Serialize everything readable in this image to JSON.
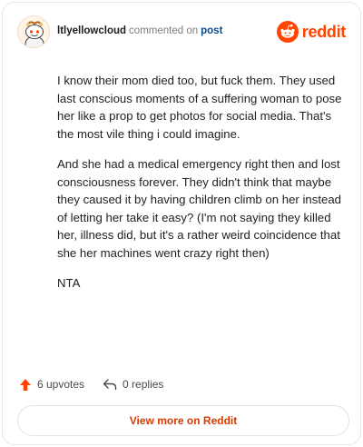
{
  "header": {
    "username": "ltlyellowcloud",
    "action_text": "commented on",
    "post_link": "post",
    "brand_name": "reddit"
  },
  "comment": {
    "paragraphs": [
      "I know their mom died too, but fuck them. They used last conscious moments of a suffering woman to pose her like a prop to get photos for social media. That's the most vile thing i could imagine.",
      "And she had a medical emergency right then and lost consciousness forever. They didn't think that maybe they caused it by having children climb on her instead of letting her take it easy? (I'm not saying they killed her, illness did, but it's a rather weird coincidence that she her machines went crazy right then)",
      "NTA"
    ]
  },
  "stats": {
    "upvotes_label": "6 upvotes",
    "replies_label": "0 replies"
  },
  "view_more_label": "View more on Reddit",
  "colors": {
    "brand": "#ff4500",
    "link": "#0a4a8f",
    "upvote": "#ff4500",
    "cta": "#d93a00"
  },
  "icons": {
    "avatar": "snoo-avatar",
    "brand": "reddit-logo-icon",
    "upvote": "upvote-arrow-icon",
    "reply": "reply-arrow-icon"
  }
}
